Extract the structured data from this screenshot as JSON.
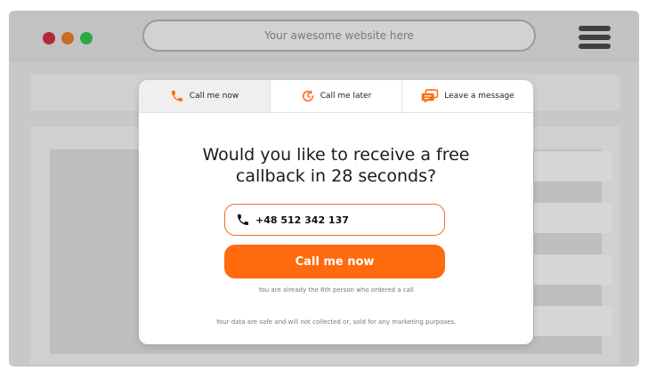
{
  "browser": {
    "address": "Your awesome website here",
    "colors": {
      "dot_red": "#b22a3a",
      "dot_orange": "#cc6a26",
      "dot_green": "#2aa84a"
    }
  },
  "popup": {
    "tabs": [
      {
        "label": "Call me now",
        "icon": "phone-icon",
        "active": true
      },
      {
        "label": "Call me later",
        "icon": "clock-icon",
        "active": false
      },
      {
        "label": "Leave a message",
        "icon": "message-icon",
        "active": false
      }
    ],
    "headline_line1": "Would you like to receive a free",
    "headline_line2": "callback in 28 seconds?",
    "phone_value": "+48 512 342 137",
    "button_label": "Call me now",
    "already_text": "You are already the 6th person who ordered a call",
    "disclaimer": "Your data are safe and will not collected or, sold for any marketing purposes.",
    "accent_color": "#ff6a0e"
  }
}
